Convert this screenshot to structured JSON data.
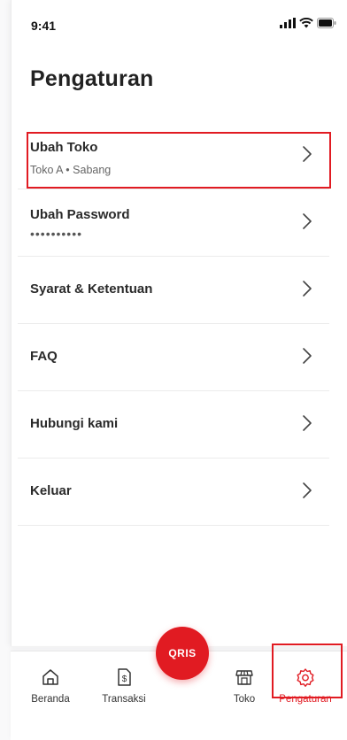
{
  "status_bar": {
    "time": "9:41"
  },
  "page": {
    "title": "Pengaturan"
  },
  "menu": [
    {
      "label": "Ubah Toko",
      "sub": "Toko A • Sabang"
    },
    {
      "label": "Ubah Password",
      "sub": "••••••••••"
    },
    {
      "label": "Syarat & Ketentuan"
    },
    {
      "label": "FAQ"
    },
    {
      "label": "Hubungi kami"
    },
    {
      "label": "Keluar"
    }
  ],
  "qris_button": {
    "label": "QRIS"
  },
  "bottom_nav": {
    "items": [
      {
        "label": "Beranda",
        "icon": "home-icon"
      },
      {
        "label": "Transaksi",
        "icon": "receipt-icon"
      },
      {
        "label": "Toko",
        "icon": "store-icon"
      },
      {
        "label": "Pengaturan",
        "icon": "gear-icon",
        "active": true
      }
    ]
  },
  "colors": {
    "accent": "#e11b22",
    "text": "#2a2a2a",
    "muted": "#666666",
    "divider": "#ececec"
  }
}
